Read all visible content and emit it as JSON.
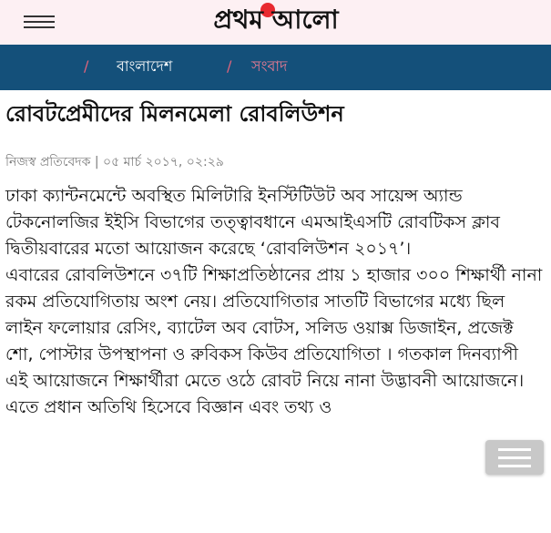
{
  "header": {
    "menu_icon": "hamburger-menu-icon",
    "logo_text": "প্রথম আলো",
    "logo_accent_color": "#e8292f"
  },
  "breadcrumb": {
    "separator": "/",
    "items": [
      {
        "label": "বাংলাদেশ"
      },
      {
        "label": "সংবাদ"
      }
    ],
    "bar_color": "#14507a"
  },
  "article": {
    "title": "রোবটপ্রেমীদের মিলনমেলা রোবলিউশন",
    "byline": "নিজস্ব প্রতিবেদক | ০৫ মার্চ ২০১৭, ০২:২৯",
    "paragraphs": [
      "ঢাকা ক্যান্টনমেন্টে অবস্থিত মিলিটারি ইনস্টিটিউট অব সায়েন্স অ্যান্ড টেকনোলজির ইইসি বিভাগের তত্ত্বাবধানে এমআইএসটি রোবটিকস ক্লাব দ্বিতীয়বারের মতো আয়োজন করেছে ‘রোবলিউশন ২০১৭’।",
      "এবারের রোবলিউশনে ৩৭টি শিক্ষাপ্রতিষ্ঠানের প্রায় ১ হাজার ৩০০ শিক্ষার্থী নানা রকম প্রতিযোগিতায় অংশ নেয়। প্রতিযোগিতার সাতটি বিভাগের মধ্যে ছিল লাইন ফলোয়ার রেসিং, ব্যাটেল অব বোটস, সলিড ওয়াক্স ডিজাইন, প্রজেক্ট শো, পোস্টার উপস্থাপনা ও রুবিকস কিউব প্রতিযোগিতা । গতকাল দিনব্যাপী এই আয়োজনে শিক্ষার্থীরা মেতে ওঠে রোবট নিয়ে নানা উদ্ভাবনী আয়োজনে। এতে প্রধান অতিথি হিসেবে বিজ্ঞান এবং তথ্য ও"
    ]
  },
  "floating_menu": {
    "icon": "floating-menu-icon"
  }
}
